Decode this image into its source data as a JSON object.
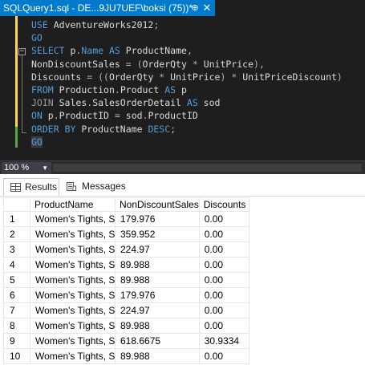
{
  "tab": {
    "title": "SQLQuery1.sql - DE...9JU7UEF\\boksi (75))*",
    "pin": "⊕",
    "close": "✕"
  },
  "editor": {
    "lines": [
      "USE AdventureWorks2012;",
      "GO",
      "SELECT p.Name AS ProductName,",
      "NonDiscountSales = (OrderQty * UnitPrice),",
      "Discounts = ((OrderQty * UnitPrice) * UnitPriceDiscount)",
      "FROM Production.Product AS p",
      "JOIN Sales.SalesOrderDetail AS sod",
      "ON p.ProductID = sod.ProductID",
      "ORDER BY ProductName DESC;",
      "GO"
    ],
    "fold_symbol": "−"
  },
  "zoom": {
    "value": "100 %",
    "arrow": "▼"
  },
  "results": {
    "tabs": [
      {
        "label": "Results"
      },
      {
        "label": "Messages"
      }
    ],
    "columns": [
      "ProductName",
      "NonDiscountSales",
      "Discounts"
    ],
    "rows": [
      {
        "n": "1",
        "name": "Women's Tights, S",
        "sales": "179.976",
        "disc": "0.00"
      },
      {
        "n": "2",
        "name": "Women's Tights, S",
        "sales": "359.952",
        "disc": "0.00"
      },
      {
        "n": "3",
        "name": "Women's Tights, S",
        "sales": "224.97",
        "disc": "0.00"
      },
      {
        "n": "4",
        "name": "Women's Tights, S",
        "sales": "89.988",
        "disc": "0.00"
      },
      {
        "n": "5",
        "name": "Women's Tights, S",
        "sales": "89.988",
        "disc": "0.00"
      },
      {
        "n": "6",
        "name": "Women's Tights, S",
        "sales": "179.976",
        "disc": "0.00"
      },
      {
        "n": "7",
        "name": "Women's Tights, S",
        "sales": "224.97",
        "disc": "0.00"
      },
      {
        "n": "8",
        "name": "Women's Tights, S",
        "sales": "89.988",
        "disc": "0.00"
      },
      {
        "n": "9",
        "name": "Women's Tights, S",
        "sales": "618.6675",
        "disc": "30.9334"
      },
      {
        "n": "10",
        "name": "Women's Tights, S",
        "sales": "89.988",
        "disc": "0.00"
      }
    ]
  },
  "colors": {
    "tab_active": "#007acc",
    "editor_bg": "#1e1e1e",
    "keyword": "#569cd6",
    "selection": "#264f78"
  }
}
